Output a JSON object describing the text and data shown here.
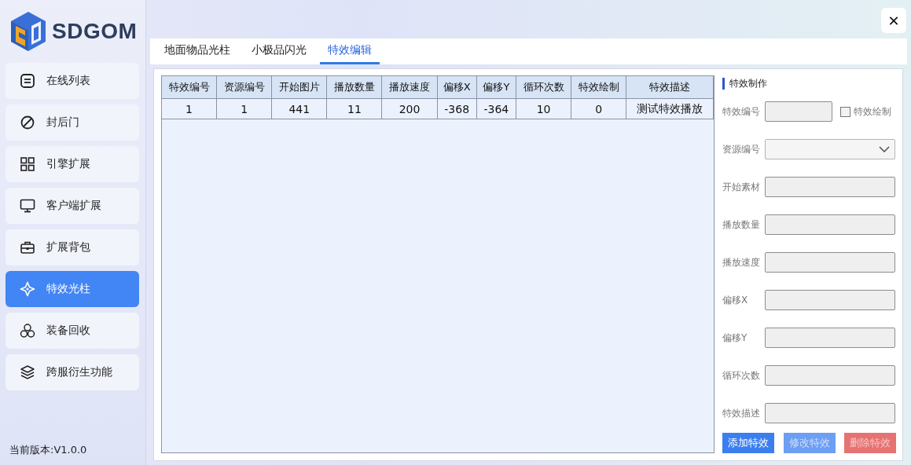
{
  "logo": {
    "text": "SDGOM"
  },
  "sidebar": {
    "items": [
      {
        "label": "在线列表",
        "selected": false
      },
      {
        "label": "封后门",
        "selected": false
      },
      {
        "label": "引擎扩展",
        "selected": false
      },
      {
        "label": "客户端扩展",
        "selected": false
      },
      {
        "label": "扩展背包",
        "selected": false
      },
      {
        "label": "特效光柱",
        "selected": true
      },
      {
        "label": "装备回收",
        "selected": false
      },
      {
        "label": "跨服衍生功能",
        "selected": false
      }
    ],
    "version": "当前版本:V1.0.0"
  },
  "close_button": {
    "label": "✕"
  },
  "tabs": [
    {
      "label": "地面物品光柱",
      "selected": false
    },
    {
      "label": "小极品闪光",
      "selected": false
    },
    {
      "label": "特效编辑",
      "selected": true
    }
  ],
  "table": {
    "columns": [
      "特效编号",
      "资源编号",
      "开始图片",
      "播放数量",
      "播放速度",
      "偏移X",
      "偏移Y",
      "循环次数",
      "特效绘制",
      "特效描述"
    ],
    "rows": [
      [
        "1",
        "1",
        "441",
        "11",
        "200",
        "-368",
        "-364",
        "10",
        "0",
        "测试特效播放"
      ]
    ]
  },
  "form": {
    "title": "特效制作",
    "fields": [
      {
        "label": "特效编号",
        "kind": "text"
      },
      {
        "label": "资源编号",
        "kind": "select"
      },
      {
        "label": "开始素材",
        "kind": "text"
      },
      {
        "label": "播放数量",
        "kind": "text"
      },
      {
        "label": "播放速度",
        "kind": "text"
      },
      {
        "label": "偏移X",
        "kind": "text"
      },
      {
        "label": "偏移Y",
        "kind": "text"
      },
      {
        "label": "循环次数",
        "kind": "text"
      },
      {
        "label": "特效描述",
        "kind": "text"
      }
    ],
    "checkbox": {
      "label": "特效绘制",
      "checked": false
    },
    "buttons": [
      {
        "label": "添加特效",
        "kind": "primary",
        "disabled": false
      },
      {
        "label": "修改特效",
        "kind": "primary",
        "disabled": true
      },
      {
        "label": "删除特效",
        "kind": "danger",
        "disabled": true
      }
    ]
  }
}
